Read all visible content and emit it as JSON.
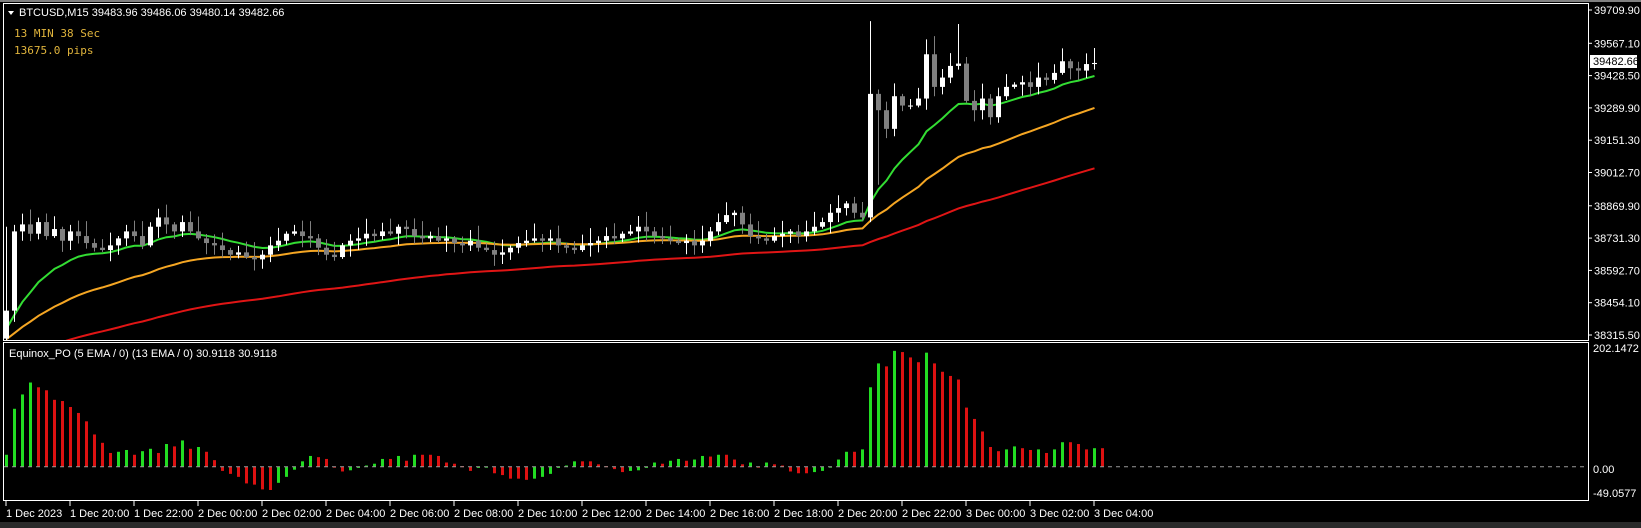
{
  "header": {
    "symbol_line": "BTCUSD,M15  39483.96 39486.06 39480.14 39482.66",
    "timer": "13 MIN 38 Sec",
    "pips": "13675.0 pips",
    "timer_color": "#e0b43c"
  },
  "indicator": {
    "title": "Equinox_PO (5 EMA / 0) (13 EMA / 0) 30.9118 30.9118",
    "axis_top": "202.1472",
    "axis_zero": "0.00",
    "axis_bottom": "-49.0577",
    "range": [
      -49.0577,
      202.1472
    ],
    "up_color": "#22dd22",
    "down_color": "#dd1111",
    "values": [
      20,
      97,
      121,
      141,
      133,
      128,
      112,
      110,
      100,
      90,
      76,
      54,
      40,
      23,
      25,
      28,
      20,
      26,
      30,
      23,
      38,
      34,
      44,
      30,
      33,
      25,
      11,
      -7,
      -12,
      -17,
      -28,
      -30,
      -38,
      -39,
      -27,
      -17,
      -5,
      9,
      18,
      16,
      13,
      0,
      -8,
      -6,
      -2,
      2,
      5,
      13,
      13,
      18,
      10,
      20,
      20,
      20,
      18,
      7,
      5,
      1,
      -7,
      -2,
      -1,
      -11,
      -14,
      -20,
      -20,
      -22,
      -20,
      -17,
      -12,
      -2,
      2,
      9,
      9,
      9,
      4,
      1,
      -4,
      -9,
      -7,
      -6,
      -2,
      7,
      5,
      10,
      13,
      10,
      12,
      18,
      17,
      20,
      20,
      12,
      4,
      7,
      -1,
      7,
      4,
      2,
      -8,
      -11,
      -11,
      -9,
      -7,
      0,
      12,
      25,
      25,
      29,
      133,
      173,
      168,
      194,
      192,
      183,
      175,
      191,
      173,
      159,
      152,
      146,
      99,
      80,
      59,
      33,
      26,
      29,
      34,
      31,
      28,
      29,
      23,
      29,
      41,
      41,
      38,
      29,
      31,
      31
    ]
  },
  "price_axis": {
    "range": [
      38315.5,
      39709.9
    ],
    "ticks": [
      "39709.90",
      "39567.10",
      "39428.50",
      "39289.90",
      "39151.30",
      "39012.70",
      "38869.90",
      "38731.30",
      "38592.70",
      "38454.10",
      "38315.50"
    ],
    "current_price": "39482.66"
  },
  "time_axis": {
    "bars_per_label": 8,
    "labels": [
      "1 Dec 2023",
      "1 Dec 20:00",
      "1 Dec 22:00",
      "2 Dec 00:00",
      "2 Dec 02:00",
      "2 Dec 04:00",
      "2 Dec 06:00",
      "2 Dec 08:00",
      "2 Dec 10:00",
      "2 Dec 12:00",
      "2 Dec 14:00",
      "2 Dec 16:00",
      "2 Dec 18:00",
      "2 Dec 20:00",
      "2 Dec 22:00",
      "3 Dec 00:00",
      "3 Dec 02:00",
      "3 Dec 04:00"
    ]
  },
  "candles": {
    "first_open": 38300,
    "bull_color": "#ffffff",
    "bear_color": "#808080",
    "closes": [
      38420,
      38760,
      38790,
      38750,
      38800,
      38740,
      38770,
      38720,
      38760,
      38740,
      38710,
      38690,
      38680,
      38700,
      38730,
      38760,
      38740,
      38700,
      38780,
      38820,
      38790,
      38760,
      38800,
      38760,
      38730,
      38710,
      38700,
      38680,
      38660,
      38670,
      38650,
      38640,
      38660,
      38700,
      38720,
      38750,
      38760,
      38740,
      38730,
      38690,
      38660,
      38650,
      38700,
      38720,
      38730,
      38750,
      38740,
      38760,
      38750,
      38780,
      38770,
      38740,
      38730,
      38740,
      38720,
      38730,
      38710,
      38700,
      38720,
      38690,
      38680,
      38660,
      38670,
      38690,
      38710,
      38720,
      38730,
      38720,
      38730,
      38700,
      38690,
      38680,
      38700,
      38710,
      38720,
      38740,
      38730,
      38750,
      38760,
      38780,
      38760,
      38740,
      38730,
      38720,
      38710,
      38720,
      38700,
      38720,
      38760,
      38800,
      38830,
      38840,
      38790,
      38740,
      38730,
      38720,
      38740,
      38750,
      38760,
      38740,
      38760,
      38780,
      38800,
      38840,
      38860,
      38880,
      38840,
      38820,
      39350,
      39280,
      39200,
      39340,
      39300,
      39300,
      39330,
      39520,
      39380,
      39420,
      39470,
      39480,
      39320,
      39280,
      39330,
      39250,
      39340,
      39380,
      39390,
      39400,
      39380,
      39420,
      39410,
      39440,
      39490,
      39460,
      39450,
      39478,
      39482.66
    ],
    "special_highs": {
      "0": 38780,
      "108": 39662,
      "116": 39598,
      "119": 39650
    },
    "special_lows": {
      "108": 38800,
      "109": 38960
    }
  },
  "moving_averages": [
    {
      "name": "fast",
      "period": 13,
      "seed": 38330,
      "color": "#33dd33"
    },
    {
      "name": "medium",
      "period": 34,
      "seed": 38290,
      "color": "#f5a623"
    },
    {
      "name": "slow",
      "period": 89,
      "seed": 38200,
      "color": "#e01515"
    }
  ]
}
